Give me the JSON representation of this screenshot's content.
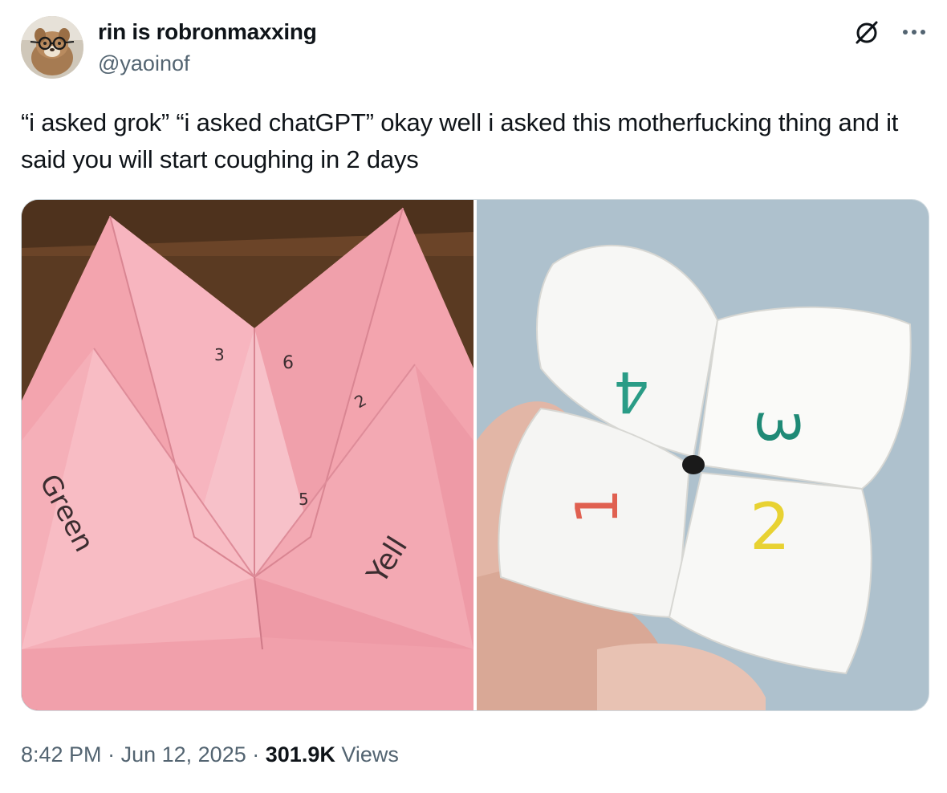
{
  "author": {
    "display_name": "rin is robronmaxxing",
    "handle": "@yaoinof"
  },
  "tweet": {
    "text": "“i asked grok” “i asked chatGPT” okay well i asked this motherfucking thing and it said you will start coughing in 2 days"
  },
  "media": [
    {
      "description": "pink paper fortune teller with handwritten numbers and colors",
      "handwriting": [
        "3",
        "6",
        "2",
        "5",
        "Green",
        "Yell"
      ]
    },
    {
      "description": "white paper fortune teller held in a hand against blue background",
      "handwriting": [
        "4",
        "3",
        "1",
        "2"
      ]
    }
  ],
  "meta": {
    "time": "8:42 PM",
    "sep1": "·",
    "date": "Jun 12, 2025",
    "sep2": "·",
    "views_count": "301.9K",
    "views_label": "Views"
  },
  "icons": {
    "grok": "grok-slash-icon",
    "more": "more-dots-icon"
  }
}
